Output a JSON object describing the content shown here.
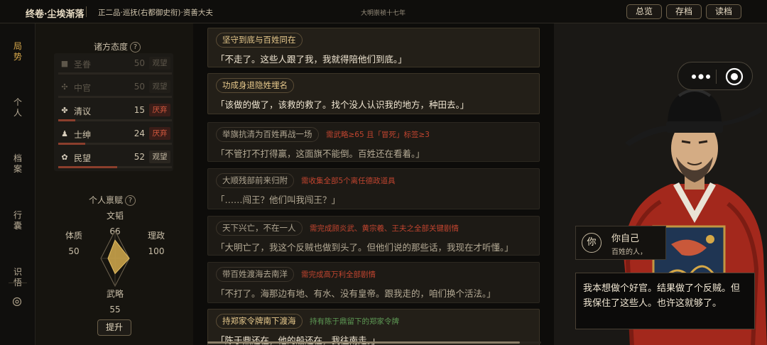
{
  "topbar": {
    "chapter": "终卷·尘埃渐落",
    "rank": "正二品·巡抚(右都御史衔)·资善大夫",
    "era": "大明崇祯十七年",
    "buttons": [
      "总览",
      "存档",
      "读档"
    ]
  },
  "nav": {
    "items": [
      {
        "label": "局势",
        "active": true,
        "icon": "situation"
      },
      {
        "label": "个人",
        "active": false,
        "icon": "personal"
      },
      {
        "label": "档案",
        "active": false,
        "icon": "archive"
      },
      {
        "label": "行囊",
        "active": false,
        "icon": "bag"
      },
      {
        "label": "识悟",
        "active": false,
        "icon": "insight"
      }
    ],
    "settings_icon": "settings-icon"
  },
  "attitudes": {
    "title": "诸方态度",
    "help": "?",
    "factions": [
      {
        "icon": "emperor-icon",
        "glyph": "■",
        "name": "圣眷",
        "value": "50",
        "tag": "观望",
        "level": 0.0,
        "dim": true
      },
      {
        "icon": "eunuch-icon",
        "glyph": "✣",
        "name": "中官",
        "value": "50",
        "tag": "观望",
        "level": 0.0,
        "dim": true
      },
      {
        "icon": "scholar-icon",
        "glyph": "✤",
        "name": "清议",
        "value": "15",
        "tag": "厌弃",
        "level": 0.15,
        "dim": false
      },
      {
        "icon": "gentry-icon",
        "glyph": "♟",
        "name": "士绅",
        "value": "24",
        "tag": "厌弃",
        "level": 0.24,
        "dim": false
      },
      {
        "icon": "people-icon",
        "glyph": "✿",
        "name": "民望",
        "value": "52",
        "tag": "观望",
        "level": 0.52,
        "dim": false
      }
    ]
  },
  "talents": {
    "title": "个人禀赋",
    "help": "?",
    "stats": [
      {
        "name": "文韬",
        "value": 66
      },
      {
        "name": "理政",
        "value": 100
      },
      {
        "name": "武略",
        "value": 55
      },
      {
        "name": "体质",
        "value": 50
      }
    ],
    "max": 100,
    "upgrade_label": "提升"
  },
  "events": [
    {
      "title": "坚守到底与百姓同在",
      "requirement": "",
      "req_color": "",
      "quote": "「不走了。这些人跟了我，我就得陪他们到底。」",
      "available": true
    },
    {
      "title": "功成身退隐姓埋名",
      "requirement": "",
      "req_color": "",
      "quote": "「该做的做了，该救的救了。找个没人认识我的地方，种田去。」",
      "available": true
    },
    {
      "title": "举旗抗清为百姓再战一场",
      "requirement": "需武略≥65 且「冒死」标签≥3",
      "req_color": "red",
      "quote": "「不管打不打得赢，这面旗不能倒。百姓还在看着。」",
      "available": false
    },
    {
      "title": "大顺残部前来归附",
      "requirement": "需收集全部5个离任德政道具",
      "req_color": "red",
      "quote": "「……闯王？他们叫我闯王？」",
      "available": false
    },
    {
      "title": "天下兴亡，不在一人",
      "requirement": "需完成顾炎武、黄宗羲、王夫之全部关键剧情",
      "req_color": "red",
      "quote": "「大明亡了，我这个反贼也做到头了。但他们说的那些话，我现在才听懂。」",
      "available": false
    },
    {
      "title": "带百姓渡海去南洋",
      "requirement": "需完成高万利全部剧情",
      "req_color": "red",
      "quote": "「不打了。海那边有地、有水、没有皇帝。跟我走的，咱们换个活法。」",
      "available": false
    },
    {
      "title": "持郑家令牌南下渡海",
      "requirement": "持有陈于鼎留下的郑家令牌",
      "req_color": "green",
      "quote": "「陈于鼎还在，他的船还在，我往南走。」",
      "available": true
    }
  ],
  "character": {
    "avatar_char": "你",
    "name": "你自己",
    "subtitle": "百姓的人，",
    "dialogue": "我本想做个好官。结果做了个反贼。但我保住了这些人。也许这就够了。"
  },
  "colors": {
    "accent": "#d8a84a",
    "hate": "#d4583e",
    "requirement_red": "#c0442f",
    "requirement_green": "#5e9a55",
    "robe": "#a3281c"
  }
}
